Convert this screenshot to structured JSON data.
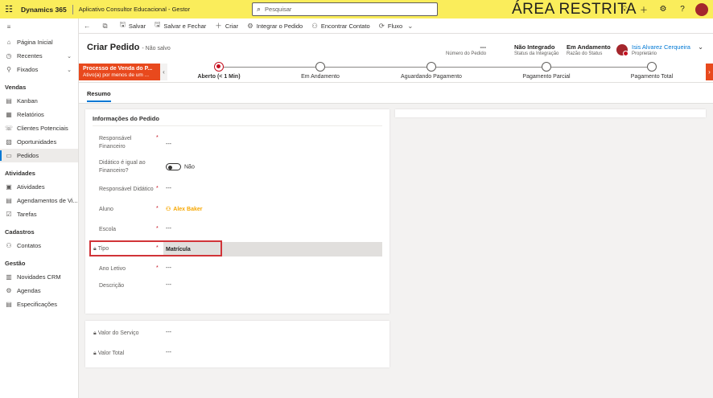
{
  "topbar": {
    "brand": "Dynamics 365",
    "app_name": "Aplicativo Consultor Educacional - Gestor",
    "search_placeholder": "Pesquisar",
    "banner": "ÁREA RESTRITA"
  },
  "sidebar": {
    "top_items": [
      {
        "label": "Página Inicial",
        "icon": "home-icon"
      },
      {
        "label": "Recentes",
        "icon": "clock-icon"
      },
      {
        "label": "Fixados",
        "icon": "pin-icon"
      }
    ],
    "groups": [
      {
        "title": "Vendas",
        "items": [
          "Kanban",
          "Relatórios",
          "Clientes Potenciais",
          "Oportunidades",
          "Pedidos"
        ]
      },
      {
        "title": "Atividades",
        "items": [
          "Atividades",
          "Agendamentos de Vi...",
          "Tarefas"
        ]
      },
      {
        "title": "Cadastros",
        "items": [
          "Contatos"
        ]
      },
      {
        "title": "Gestão",
        "items": [
          "Novidades CRM",
          "Agendas",
          "Especificações"
        ]
      }
    ]
  },
  "commands": {
    "save": "Salvar",
    "save_close": "Salvar e Fechar",
    "new": "Criar",
    "integrate": "Integrar o Pedido",
    "find_contact": "Encontrar Contato",
    "flow": "Fluxo"
  },
  "header": {
    "title": "Criar Pedido",
    "subtitle": "- Não salvo",
    "order_number_value": "---",
    "order_number_label": "Número do Pedido",
    "integration_value": "Não Integrado",
    "integration_label": "Status da Integração",
    "status_reason_value": "Em Andamento",
    "status_reason_label": "Razão do Status",
    "owner_name": "Isis Alvarez Cerqueira",
    "owner_label": "Proprietário"
  },
  "bpf": {
    "title": "Processo de Venda do P...",
    "subtitle": "Ativo(a) por menos de um ...",
    "stages": [
      "Aberto  (< 1 Min)",
      "Em Andamento",
      "Aguardando Pagamento",
      "Pagamento Parcial",
      "Pagamento Total"
    ]
  },
  "tabs": {
    "summary": "Resumo"
  },
  "form": {
    "section_title": "Informações do Pedido",
    "responsavel_financeiro_label": "Responsável Financeiro",
    "responsavel_financeiro_value": "---",
    "didatico_label": "Didático é igual ao Financeiro?",
    "didatico_value": "Não",
    "responsavel_didatico_label": "Responsável Didático",
    "responsavel_didatico_value": "---",
    "aluno_label": "Aluno",
    "aluno_value": "Alex Baker",
    "escola_label": "Escola",
    "escola_value": "---",
    "tipo_label": "Tipo",
    "tipo_value": "Matrícula",
    "ano_label": "Ano Letivo",
    "ano_value": "---",
    "descricao_label": "Descrição",
    "descricao_value": "---",
    "valor_servico_label": "Valor do Serviço",
    "valor_servico_value": "---",
    "valor_total_label": "Valor Total",
    "valor_total_value": "---",
    "required_mark": "*"
  }
}
